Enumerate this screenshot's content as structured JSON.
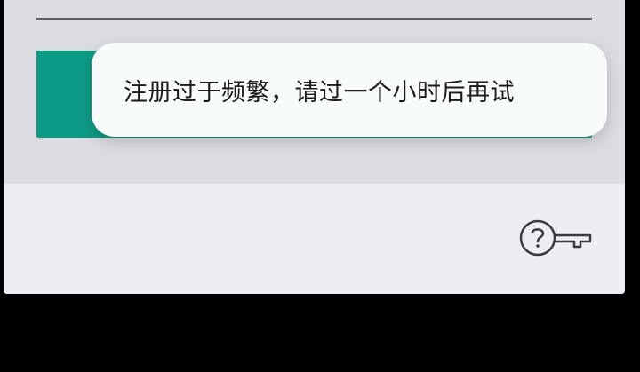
{
  "dialog": {
    "primary_button_label": "",
    "toast_message": "注册过于频繁，请过一个小时后再试",
    "help_icon": "help-key-icon"
  },
  "colors": {
    "accent": "#0e9b86",
    "card_upper": "#dcdde2",
    "card_footer": "#eceef4",
    "toast_bg": "#f7fbfa",
    "backdrop": "#000000"
  }
}
